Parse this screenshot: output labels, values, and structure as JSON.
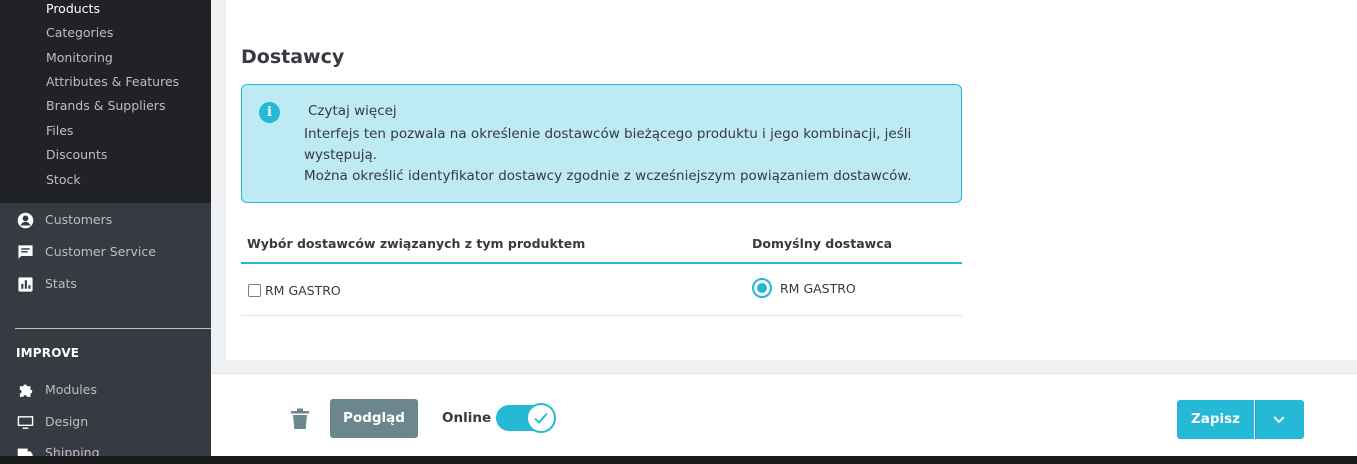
{
  "sidebar": {
    "submenu": [
      "Products",
      "Categories",
      "Monitoring",
      "Attributes & Features",
      "Brands & Suppliers",
      "Files",
      "Discounts",
      "Stock"
    ],
    "active_submenu": "Products",
    "items": [
      {
        "label": "Customers",
        "icon": "user-circle-icon"
      },
      {
        "label": "Customer Service",
        "icon": "chat-icon"
      },
      {
        "label": "Stats",
        "icon": "bar-chart-icon"
      }
    ],
    "section_title": "IMPROVE",
    "improve_items": [
      {
        "label": "Modules",
        "icon": "puzzle-icon"
      },
      {
        "label": "Design",
        "icon": "monitor-icon"
      },
      {
        "label": "Shipping",
        "icon": "truck-icon"
      }
    ]
  },
  "main": {
    "title": "Dostawcy",
    "alert": {
      "title": "Czytaj więcej",
      "line1": "Interfejs ten pozwala na określenie dostawców bieżącego produktu i jego kombinacji, jeśli występują.",
      "line2": "Można określić identyfikator dostawcy zgodnie z wcześniejszym powiązaniem dostawców."
    },
    "table": {
      "col_select": "Wybór dostawców związanych z tym produktem",
      "col_default": "Domyślny dostawca",
      "rows": [
        {
          "supplier": "RM GASTRO",
          "selected": false,
          "default_supplier": "RM GASTRO",
          "is_default": true
        }
      ]
    }
  },
  "footer": {
    "preview_label": "Podgląd",
    "online_label": "Online",
    "online_enabled": true,
    "save_label": "Zapisz"
  },
  "colors": {
    "accent": "#25b9d7",
    "sidebar_bg": "#363a41",
    "submenu_bg": "#202226",
    "alert_bg": "#beeaf3",
    "secondary_button": "#6c868e"
  }
}
